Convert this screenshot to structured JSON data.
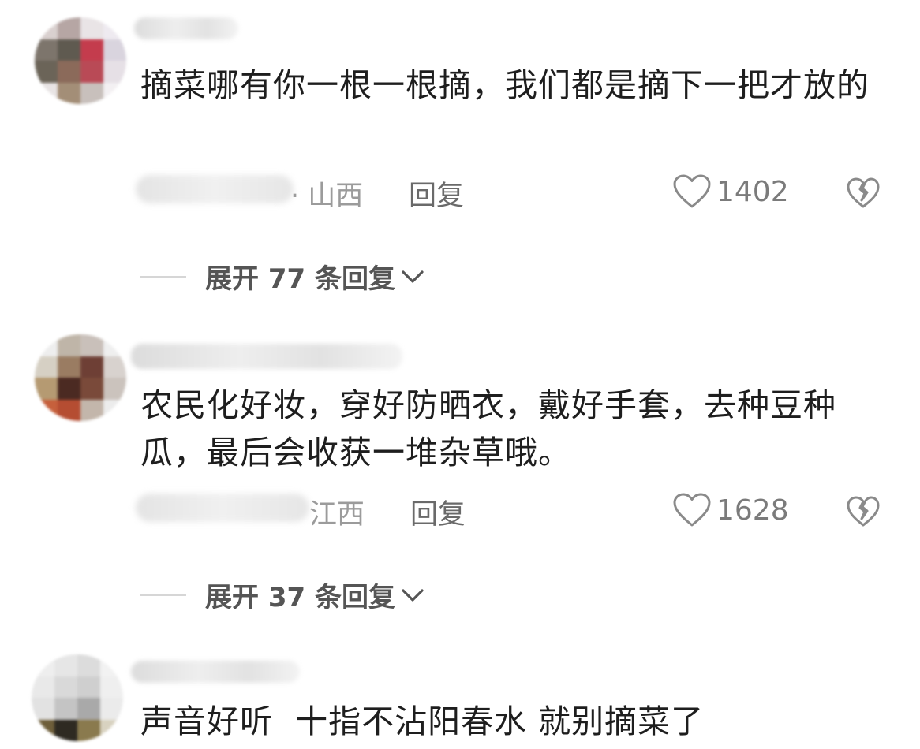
{
  "comments": [
    {
      "text": "摘菜哪有你一根一根摘，我们都是摘下一把才放的",
      "location": "· 山西",
      "reply_label": "回复",
      "likes": "1402",
      "expand_label": "展开 77 条回复"
    },
    {
      "text": "农民化好妆，穿好防晒衣，戴好手套，去种豆种瓜，最后会收获一堆杂草哦。",
      "location": "江西",
      "reply_label": "回复",
      "likes": "1628",
      "expand_label": "展开 37 条回复"
    },
    {
      "text": "声音好听  十指不沾阳春水 就别摘菜了"
    }
  ],
  "icons": {
    "like": "heart-outline-icon",
    "dislike": "broken-heart-icon",
    "expand": "chevron-down-icon"
  },
  "colors": {
    "text": "#1e1e1e",
    "meta": "#9b9b9b",
    "reply": "#6a6a6a",
    "icon": "#8a8a8a"
  }
}
